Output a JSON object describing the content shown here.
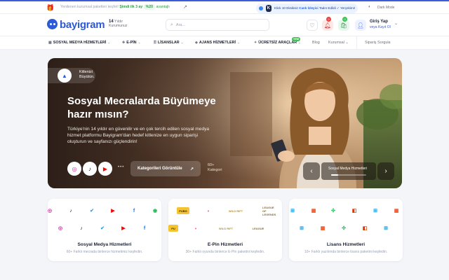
{
  "topbar": {
    "promo_prefix": "Yenilenen kurumsal paketleri keşfet!",
    "promo_highlight": "Şimdi ilk 3 ay",
    "promo_badge": "%20",
    "promo_suffix": "avantajlı",
    "badge_k": "K",
    "badge_text_prefix": "Klick 10 Eksiksiz",
    "badge_text_mid": "Canlı İzleyici",
    "badge_text_suffix": "Tadın Edildi ✓ Yerçekimi!",
    "dark_mode_label": "Dark Mode"
  },
  "header": {
    "logo_text": "bayigram",
    "years_number": "14",
    "years_line1": "Yıldır",
    "years_line2": "Kurumunuz",
    "search_placeholder": "Ara...",
    "bell_count": "0",
    "cart_count": "0",
    "login_label": "Giriş Yap",
    "signup_label": "veya Kayıt Ol"
  },
  "nav": {
    "items": [
      {
        "label": "SOSYAL MEDYA HİZMETLERİ"
      },
      {
        "label": "E-PİN"
      },
      {
        "label": "LİSANSLAR"
      },
      {
        "label": "AJANS HİZMETLERİ"
      },
      {
        "label": "ÜCRETSİZ ARAÇLAR"
      }
    ],
    "new_badge": "YENİ",
    "blog": "Blog",
    "corporate": "Kurumsal",
    "order_query": "Sipariş Sorgula"
  },
  "hero": {
    "tag_line1": "Kitlenizi",
    "tag_line2": "Büyütün.",
    "headline": "Sosyal Mecralarda Büyümeye hazır mısın?",
    "description": "Türkiye'nin 14 yıldır en güvenilir ve en çok tercih edilen sosyal medya hizmet platformu Bayigram'dan hedef kitlenize en uygun siparişi oluşturun ve sayfanızı güçlendirin!",
    "cta_label": "Kategorileri Görüntüle",
    "count_line1": "60+",
    "count_line2": "Kategori",
    "slide_label": "Sosyal Medya Hizmetleri",
    "slide_progress": 0.2
  },
  "cards": [
    {
      "title": "Sosyal Medya Hizmetleri",
      "sub": "60+ Farklı mecrada binlerce hizmetimiz keşfedin."
    },
    {
      "title": "E-Pin Hizmetleri",
      "sub": "30+ Farklı oyunda binlerce E-Pin paketini keşfedin."
    },
    {
      "title": "Lisans Hizmetleri",
      "sub": "10+ Farklı yazılımda binlerce lisans paketini keşfedin."
    }
  ],
  "card_brands": {
    "game_logos": [
      "PUBG",
      "VALORANT",
      "WILD RIFT",
      "LEAGUE OF LEGENDS"
    ]
  },
  "colors": {
    "brand": "#2d5bd8",
    "instagram": "#d6249f",
    "twitter": "#1da1f2",
    "youtube": "#ff0000",
    "facebook": "#1877f2",
    "spotify": "#1db954",
    "tiktok": "#111111",
    "windows": "#00a4ef",
    "office": "#d83b01"
  }
}
